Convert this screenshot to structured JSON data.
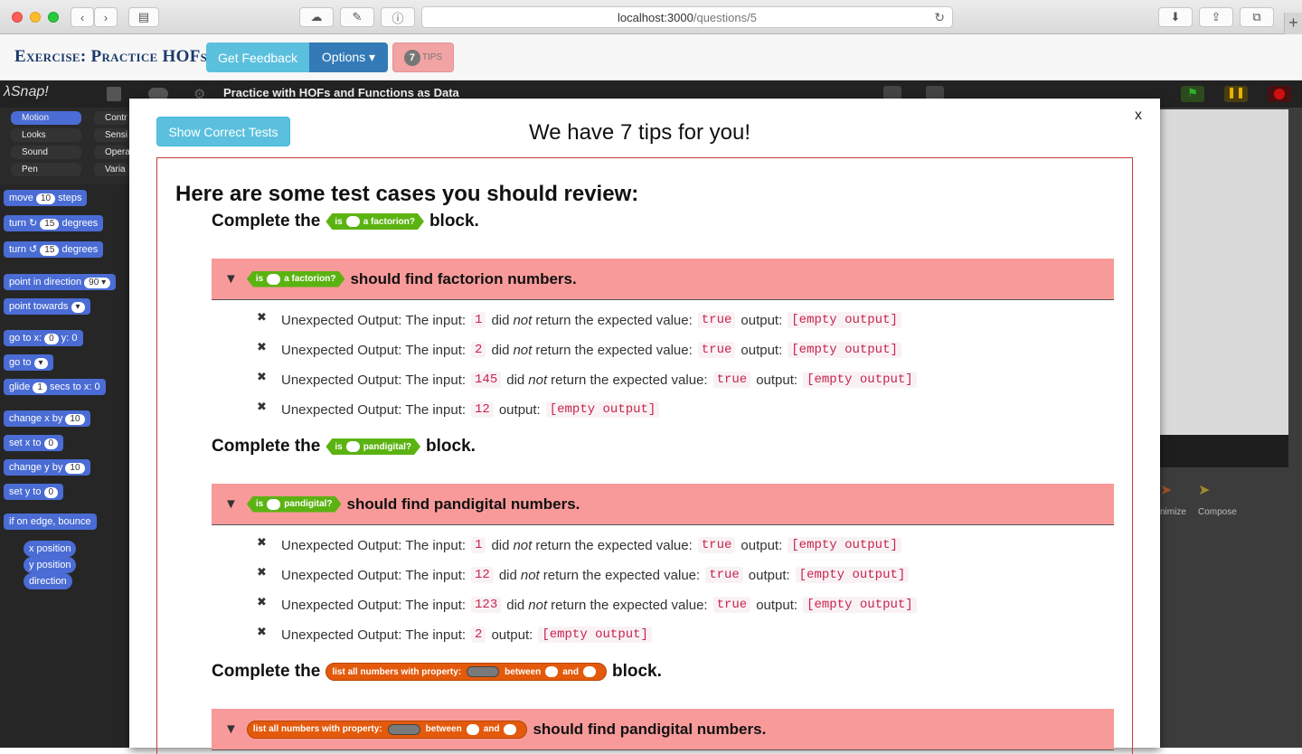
{
  "browser": {
    "url_host": "localhost:3000",
    "url_path": "/questions/5",
    "new_tab_label": "+"
  },
  "app": {
    "title": "Exercise: Practice HOFs",
    "get_feedback": "Get Feedback",
    "options": "Options ▾",
    "tips_count": "7",
    "tips_label": "TIPS"
  },
  "snap": {
    "logo": "λSnap!",
    "project_title": "Practice with HOFs and Functions as Data",
    "categories": [
      "Motion",
      "Looks",
      "Sound",
      "Pen",
      "Contr",
      "Sensi",
      "Opera",
      "Varia"
    ],
    "blocks": [
      {
        "pre": "move",
        "slot": "10",
        "post": "steps"
      },
      {
        "pre": "turn ↻",
        "slot": "15",
        "post": "degrees"
      },
      {
        "pre": "turn ↺",
        "slot": "15",
        "post": "degrees"
      },
      {
        "pre": "point in direction",
        "slot": "90 ▾",
        "post": ""
      },
      {
        "pre": "point towards",
        "slot": "▾",
        "post": ""
      },
      {
        "pre": "go to x:",
        "slot": "0",
        "post": "y: 0"
      },
      {
        "pre": "go to",
        "slot": "▾",
        "post": ""
      },
      {
        "pre": "glide",
        "slot": "1",
        "post": "secs to x: 0"
      },
      {
        "pre": "change x by",
        "slot": "10",
        "post": ""
      },
      {
        "pre": "set x to",
        "slot": "0",
        "post": ""
      },
      {
        "pre": "change y by",
        "slot": "10",
        "post": ""
      },
      {
        "pre": "set y to",
        "slot": "0",
        "post": ""
      },
      {
        "pre": "if on edge, bounce",
        "slot": "",
        "post": ""
      },
      {
        "pre": "x position",
        "slot": "",
        "post": ""
      },
      {
        "pre": "y position",
        "slot": "",
        "post": ""
      },
      {
        "pre": "direction",
        "slot": "",
        "post": ""
      }
    ],
    "corral_labels": [
      "nimize",
      "Compose"
    ]
  },
  "modal": {
    "show_correct": "Show Correct Tests",
    "title": "We have 7 tips for you!",
    "close": "x",
    "heading": "Here are some test cases you should review:",
    "complete_prefix": "Complete the",
    "complete_suffix": "block.",
    "sections": [
      {
        "block": "factorion",
        "should": "should find factorion numbers.",
        "rows": [
          {
            "input": "1",
            "expected": "true",
            "output": "[empty output]"
          },
          {
            "input": "2",
            "expected": "true",
            "output": "[empty output]"
          },
          {
            "input": "145",
            "expected": "true",
            "output": "[empty output]"
          },
          {
            "input": "12",
            "expected": "",
            "output": "[empty output]"
          }
        ]
      },
      {
        "block": "pandigital",
        "should": "should find pandigital numbers.",
        "rows": [
          {
            "input": "1",
            "expected": "true",
            "output": "[empty output]"
          },
          {
            "input": "12",
            "expected": "true",
            "output": "[empty output]"
          },
          {
            "input": "123",
            "expected": "true",
            "output": "[empty output]"
          },
          {
            "input": "2",
            "expected": "",
            "output": "[empty output]"
          }
        ]
      },
      {
        "block": "list",
        "should": "should find pandigital numbers.",
        "rows": []
      }
    ],
    "blocks": {
      "factorion": {
        "is": "is",
        "label": "a factorion?"
      },
      "pandigital": {
        "is": "is",
        "label": "pandigital?"
      },
      "list": {
        "label": "list all numbers with property:",
        "between": "between",
        "and": "and"
      }
    },
    "row_text": {
      "prefix": "Unexpected Output: The input:",
      "did": "did",
      "not": "not",
      "returned": "return the expected value:",
      "output": "output:"
    }
  }
}
